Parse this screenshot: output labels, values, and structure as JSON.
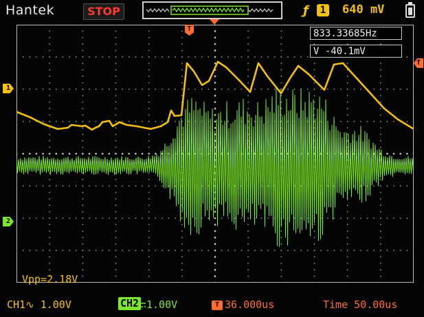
{
  "header": {
    "brand": "Hantek",
    "run_state": "STOP",
    "trigger_channel": "1",
    "trigger_level": "640 mV",
    "edge_icon": "rising-edge-icon",
    "battery_icon": "battery-icon"
  },
  "measurements": {
    "frequency": "833.33685Hz",
    "voltage": "V -40.1mV",
    "vpp": "Vpp=2.18V"
  },
  "markers": {
    "ch1": "1",
    "ch2": "2",
    "trigger_pos": "T",
    "trigger_right": "T"
  },
  "footer": {
    "ch1": "CH1∿ 1.00V",
    "ch2_label": "CH2",
    "ch2_coupling_icon": "dc-coupling-icon",
    "ch2_scale": "1.00V",
    "trigger_offset": "36.000us",
    "timebase": "Time 50.00us"
  },
  "colors": {
    "ch1": "#f4c10b",
    "ch2": "#7ce82a",
    "grid": "#cfcfcf",
    "accent": "#ff6d2e",
    "stop": "#ff3b2f"
  }
}
